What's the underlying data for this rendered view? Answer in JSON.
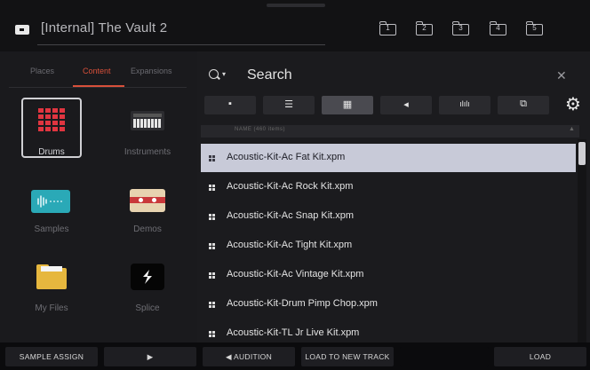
{
  "location": {
    "title": "[Internal] The Vault 2",
    "folders": [
      "1",
      "2",
      "3",
      "4",
      "5"
    ]
  },
  "left_panel": {
    "tabs": [
      "Places",
      "Content",
      "Expansions"
    ],
    "active_tab": "Content",
    "tiles": [
      {
        "label": "Drums",
        "icon": "drum-pads-icon",
        "selected": true
      },
      {
        "label": "Instruments",
        "icon": "keyboard-icon",
        "selected": false
      },
      {
        "label": "Samples",
        "icon": "waveform-icon",
        "selected": false
      },
      {
        "label": "Demos",
        "icon": "cassette-icon",
        "selected": false
      },
      {
        "label": "My Files",
        "icon": "folder-icon",
        "selected": false
      },
      {
        "label": "Splice",
        "icon": "splice-logo-icon",
        "selected": false
      }
    ]
  },
  "search": {
    "title": "Search",
    "filters": [
      {
        "icon": "file-icon",
        "glyph": "▪"
      },
      {
        "icon": "sliders-icon",
        "glyph": "☰"
      },
      {
        "icon": "grid-icon",
        "glyph": "▦"
      },
      {
        "icon": "plugin-icon",
        "glyph": "◂"
      },
      {
        "icon": "waveform-icon",
        "glyph": "ılılı"
      },
      {
        "icon": "copy-icon",
        "glyph": "⧉"
      }
    ],
    "active_filter": 2,
    "list_header": "NAME (460 items)",
    "items": [
      "Acoustic-Kit-Ac Fat Kit.xpm",
      "Acoustic-Kit-Ac Rock Kit.xpm",
      "Acoustic-Kit-Ac Snap Kit.xpm",
      "Acoustic-Kit-Ac Tight Kit.xpm",
      "Acoustic-Kit-Ac Vintage Kit.xpm",
      "Acoustic-Kit-Drum Pimp Chop.xpm",
      "Acoustic-Kit-TL Jr Live Kit.xpm"
    ],
    "selected_index": 0
  },
  "bottom_bar": {
    "sample_assign": "SAMPLE ASSIGN",
    "play": "▶",
    "audition": "◀ AUDITION",
    "load_to_new_track": "LOAD TO NEW TRACK",
    "load": "LOAD"
  },
  "colors": {
    "accent": "#d8503a",
    "drums": "#e03540",
    "samples": "#2aa9b7",
    "files": "#e6b73e",
    "selection": "#c8cad8"
  }
}
